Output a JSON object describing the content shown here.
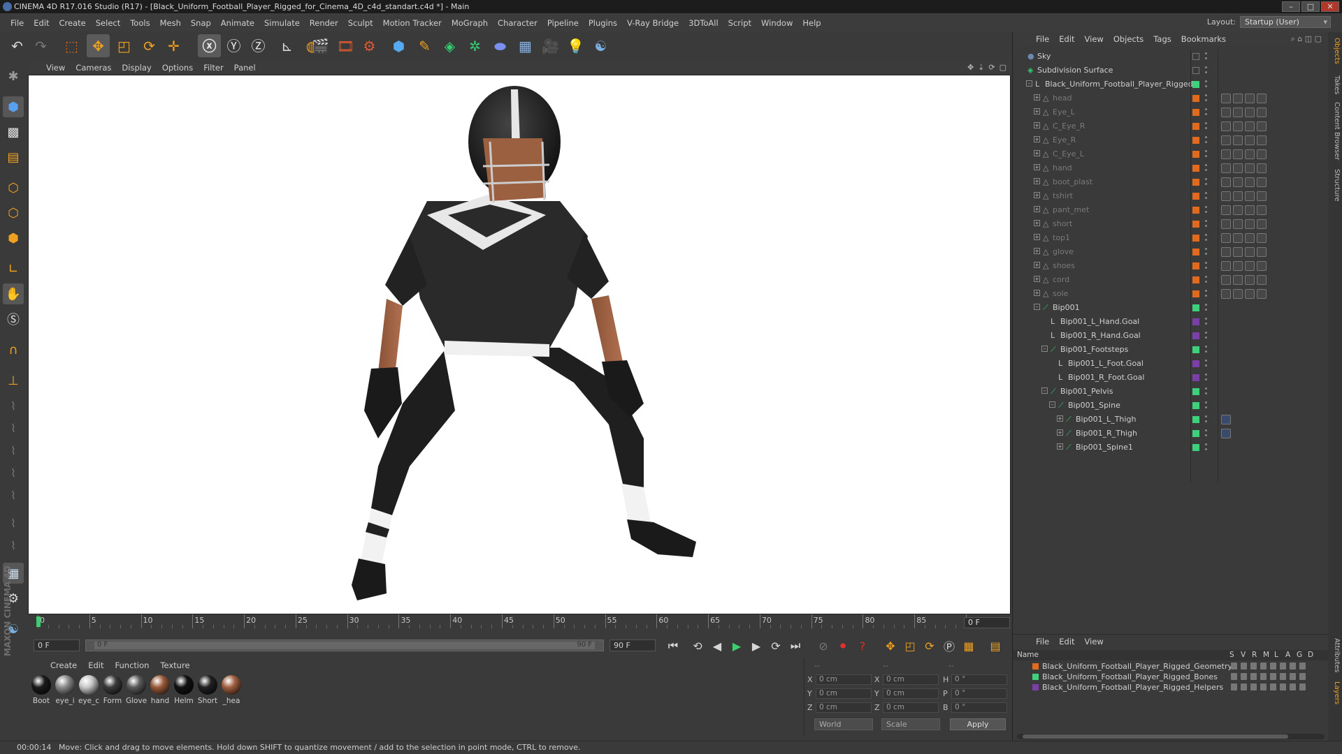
{
  "title": "CINEMA 4D R17.016 Studio (R17) - [Black_Uniform_Football_Player_Rigged_for_Cinema_4D_c4d_standart.c4d *] - Main",
  "menu": [
    "File",
    "Edit",
    "Create",
    "Select",
    "Tools",
    "Mesh",
    "Snap",
    "Animate",
    "Simulate",
    "Render",
    "Sculpt",
    "Motion Tracker",
    "MoGraph",
    "Character",
    "Pipeline",
    "Plugins",
    "V-Ray Bridge",
    "3DToAll",
    "Script",
    "Window",
    "Help"
  ],
  "layout": {
    "label": "Layout:",
    "value": "Startup (User)"
  },
  "viewport_menu": [
    "View",
    "Cameras",
    "Display",
    "Options",
    "Filter",
    "Panel"
  ],
  "objects_menu": [
    "File",
    "Edit",
    "View",
    "Objects",
    "Tags",
    "Bookmarks"
  ],
  "objects": [
    {
      "name": "Sky",
      "indent": 0,
      "expand": "",
      "icon": "sky",
      "swatch": "",
      "color": "#d0d0d0"
    },
    {
      "name": "Subdivision Surface",
      "indent": 0,
      "expand": "",
      "icon": "subd",
      "swatch": "",
      "color": "#d0d0d0"
    },
    {
      "name": "Black_Uniform_Football_Player_Rigged",
      "indent": 1,
      "expand": "-",
      "icon": "null",
      "swatch": "#3ed07a",
      "color": "#d0d0d0"
    },
    {
      "name": "head",
      "indent": 2,
      "expand": "+",
      "icon": "poly",
      "swatch": "#e06a1e",
      "color": "#7a7a7a"
    },
    {
      "name": "Eye_L",
      "indent": 2,
      "expand": "+",
      "icon": "poly",
      "swatch": "#e06a1e",
      "color": "#7a7a7a"
    },
    {
      "name": "C_Eye_R",
      "indent": 2,
      "expand": "+",
      "icon": "poly",
      "swatch": "#e06a1e",
      "color": "#7a7a7a"
    },
    {
      "name": "Eye_R",
      "indent": 2,
      "expand": "+",
      "icon": "poly",
      "swatch": "#e06a1e",
      "color": "#7a7a7a"
    },
    {
      "name": "C_Eye_L",
      "indent": 2,
      "expand": "+",
      "icon": "poly",
      "swatch": "#e06a1e",
      "color": "#7a7a7a"
    },
    {
      "name": "hand",
      "indent": 2,
      "expand": "+",
      "icon": "poly",
      "swatch": "#e06a1e",
      "color": "#7a7a7a"
    },
    {
      "name": "boot_plast",
      "indent": 2,
      "expand": "+",
      "icon": "poly",
      "swatch": "#e06a1e",
      "color": "#7a7a7a"
    },
    {
      "name": "tshirt",
      "indent": 2,
      "expand": "+",
      "icon": "poly",
      "swatch": "#e06a1e",
      "color": "#7a7a7a"
    },
    {
      "name": "pant_met",
      "indent": 2,
      "expand": "+",
      "icon": "poly",
      "swatch": "#e06a1e",
      "color": "#7a7a7a"
    },
    {
      "name": "short",
      "indent": 2,
      "expand": "+",
      "icon": "poly",
      "swatch": "#e06a1e",
      "color": "#7a7a7a"
    },
    {
      "name": "top1",
      "indent": 2,
      "expand": "+",
      "icon": "poly",
      "swatch": "#e06a1e",
      "color": "#7a7a7a"
    },
    {
      "name": "glove",
      "indent": 2,
      "expand": "+",
      "icon": "poly",
      "swatch": "#e06a1e",
      "color": "#7a7a7a"
    },
    {
      "name": "shoes",
      "indent": 2,
      "expand": "+",
      "icon": "poly",
      "swatch": "#e06a1e",
      "color": "#7a7a7a"
    },
    {
      "name": "cord",
      "indent": 2,
      "expand": "+",
      "icon": "poly",
      "swatch": "#e06a1e",
      "color": "#7a7a7a"
    },
    {
      "name": "sole",
      "indent": 2,
      "expand": "+",
      "icon": "poly",
      "swatch": "#e06a1e",
      "color": "#7a7a7a"
    },
    {
      "name": "Bip001",
      "indent": 2,
      "expand": "-",
      "icon": "bone",
      "swatch": "#3ed07a",
      "color": "#d0d0d0"
    },
    {
      "name": "Bip001_L_Hand.Goal",
      "indent": 3,
      "expand": "",
      "icon": "null",
      "swatch": "#7b3fa8",
      "color": "#d0d0d0"
    },
    {
      "name": "Bip001_R_Hand.Goal",
      "indent": 3,
      "expand": "",
      "icon": "null",
      "swatch": "#7b3fa8",
      "color": "#d0d0d0"
    },
    {
      "name": "Bip001_Footsteps",
      "indent": 3,
      "expand": "-",
      "icon": "bone",
      "swatch": "#3ed07a",
      "color": "#d0d0d0"
    },
    {
      "name": "Bip001_L_Foot.Goal",
      "indent": 4,
      "expand": "",
      "icon": "null",
      "swatch": "#7b3fa8",
      "color": "#d0d0d0"
    },
    {
      "name": "Bip001_R_Foot.Goal",
      "indent": 4,
      "expand": "",
      "icon": "null",
      "swatch": "#7b3fa8",
      "color": "#d0d0d0"
    },
    {
      "name": "Bip001_Pelvis",
      "indent": 3,
      "expand": "-",
      "icon": "bone",
      "swatch": "#3ed07a",
      "color": "#d0d0d0"
    },
    {
      "name": "Bip001_Spine",
      "indent": 4,
      "expand": "-",
      "icon": "bone",
      "swatch": "#3ed07a",
      "color": "#d0d0d0"
    },
    {
      "name": "Bip001_L_Thigh",
      "indent": 5,
      "expand": "+",
      "icon": "bone",
      "swatch": "#3ed07a",
      "color": "#d0d0d0"
    },
    {
      "name": "Bip001_R_Thigh",
      "indent": 5,
      "expand": "+",
      "icon": "bone",
      "swatch": "#3ed07a",
      "color": "#d0d0d0"
    },
    {
      "name": "Bip001_Spine1",
      "indent": 5,
      "expand": "+",
      "icon": "bone",
      "swatch": "#3ed07a",
      "color": "#d0d0d0"
    }
  ],
  "timeline": {
    "ticks": [
      "0",
      "5",
      "10",
      "15",
      "20",
      "25",
      "30",
      "35",
      "40",
      "45",
      "50",
      "55",
      "60",
      "65",
      "70",
      "75",
      "80",
      "85",
      "90"
    ],
    "current_frame": "0 F",
    "start_field": "0 F",
    "slider_start": "0 F",
    "slider_end": "90 F",
    "end_field": "90 F"
  },
  "material_menu": [
    "Create",
    "Edit",
    "Function",
    "Texture"
  ],
  "materials": [
    {
      "name": "Boot",
      "color": "#1a1a1a"
    },
    {
      "name": "eye_i",
      "color": "#8a8a8a"
    },
    {
      "name": "eye_c",
      "color": "#c8c8c8"
    },
    {
      "name": "Form",
      "color": "#3a3a3a"
    },
    {
      "name": "Glove",
      "color": "#5a5a5a"
    },
    {
      "name": "hand",
      "color": "#9a5a3a"
    },
    {
      "name": "Helm",
      "color": "#111111"
    },
    {
      "name": "Short",
      "color": "#202020"
    },
    {
      "name": "_hea",
      "color": "#a06040"
    }
  ],
  "coords": {
    "head": [
      "--",
      "--",
      "--"
    ],
    "rows": [
      {
        "a": "X",
        "av": "0 cm",
        "b": "X",
        "bv": "0 cm",
        "c": "H",
        "cv": "0 °"
      },
      {
        "a": "Y",
        "av": "0 cm",
        "b": "Y",
        "bv": "0 cm",
        "c": "P",
        "cv": "0 °"
      },
      {
        "a": "Z",
        "av": "0 cm",
        "b": "Z",
        "bv": "0 cm",
        "c": "B",
        "cv": "0 °"
      }
    ],
    "mode": "World",
    "scale": "Scale",
    "apply": "Apply"
  },
  "layers_menu": [
    "File",
    "Edit",
    "View"
  ],
  "layers_header": {
    "name": "Name",
    "cols": [
      "S",
      "V",
      "R",
      "M",
      "L",
      "A",
      "G",
      "D"
    ]
  },
  "layers": [
    {
      "name": "Black_Uniform_Football_Player_Rigged_Geometry",
      "color": "#e06a1e"
    },
    {
      "name": "Black_Uniform_Football_Player_Rigged_Bones",
      "color": "#3ed07a"
    },
    {
      "name": "Black_Uniform_Football_Player_Rigged_Helpers",
      "color": "#7b3fa8"
    }
  ],
  "side_tabs": [
    "Objects",
    "Takes",
    "Content Browser",
    "Structure"
  ],
  "side_tabs_lower": [
    "Attributes",
    "Layers"
  ],
  "status": {
    "time": "00:00:14",
    "message": "Move: Click and drag to move elements. Hold down SHIFT to quantize movement / add to the selection in point mode, CTRL to remove."
  },
  "logo": "MAXON CINEMA 4D"
}
